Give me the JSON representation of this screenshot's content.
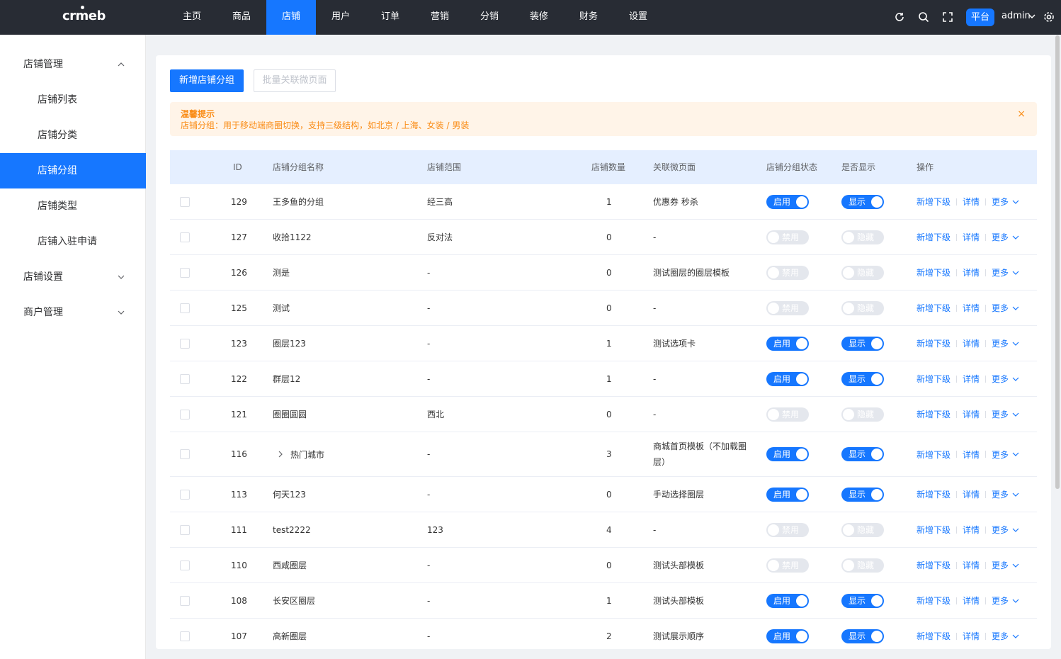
{
  "topbar": {
    "logo_text": "crmeb",
    "nav": [
      "主页",
      "商品",
      "店铺",
      "用户",
      "订单",
      "营销",
      "分销",
      "装修",
      "财务",
      "设置"
    ],
    "active_nav_index": 2,
    "platform_label": "平台",
    "user_name": "admin",
    "icons": [
      "refresh-icon",
      "search-icon",
      "fullscreen-icon",
      "chevron-down-icon",
      "settings-icon"
    ]
  },
  "sidebar": {
    "groups": [
      {
        "label": "店铺管理",
        "expanded": true,
        "items": [
          "店铺列表",
          "店铺分类",
          "店铺分组",
          "店铺类型",
          "店铺入驻申请"
        ]
      },
      {
        "label": "店铺设置",
        "expanded": false
      },
      {
        "label": "商户管理",
        "expanded": false
      }
    ],
    "active_item": "店铺分组"
  },
  "toolbar": {
    "add_label": "新增店铺分组",
    "batch_label": "批量关联微页面"
  },
  "alert": {
    "title": "温馨提示",
    "text": "店铺分组：用于移动端商圈切换，支持三级结构，如北京 / 上海、女装 / 男装",
    "close": "×"
  },
  "table": {
    "headers": [
      "ID",
      "店铺分组名称",
      "店铺范围",
      "店铺数量",
      "关联微页面",
      "店铺分组状态",
      "是否显示",
      "操作"
    ],
    "status_labels": {
      "on": "启用",
      "off": "禁用"
    },
    "show_labels": {
      "on": "显示",
      "off": "隐藏"
    },
    "actions": {
      "add_child": "新增下级",
      "detail": "详情",
      "more": "更多"
    },
    "rows": [
      {
        "id": "129",
        "name": "王多鱼的分组",
        "scope": "经三高",
        "count": "1",
        "page": "优惠券 秒杀",
        "status": true,
        "show": true
      },
      {
        "id": "127",
        "name": "收拾1122",
        "scope": "反对法",
        "count": "0",
        "page": "-",
        "status": false,
        "show": false
      },
      {
        "id": "126",
        "name": "测是",
        "scope": "-",
        "count": "0",
        "page": "测试圈层的圈层模板",
        "status": false,
        "show": false
      },
      {
        "id": "125",
        "name": "测试",
        "scope": "-",
        "count": "0",
        "page": "-",
        "status": false,
        "show": false
      },
      {
        "id": "123",
        "name": "圈层123",
        "scope": "-",
        "count": "1",
        "page": "测试选项卡",
        "status": true,
        "show": true
      },
      {
        "id": "122",
        "name": "群层12",
        "scope": "-",
        "count": "1",
        "page": "-",
        "status": true,
        "show": true
      },
      {
        "id": "121",
        "name": "圈圈圆圆",
        "scope": "西北",
        "count": "0",
        "page": "-",
        "status": false,
        "show": false
      },
      {
        "id": "116",
        "name": "热门城市",
        "scope": "-",
        "count": "3",
        "page": "商城首页模板（不加载圈层）",
        "status": true,
        "show": true,
        "expandable": true
      },
      {
        "id": "113",
        "name": "何天123",
        "scope": "-",
        "count": "0",
        "page": "手动选择圈层",
        "status": true,
        "show": true
      },
      {
        "id": "111",
        "name": "test2222",
        "scope": "123",
        "count": "4",
        "page": "-",
        "status": false,
        "show": false
      },
      {
        "id": "110",
        "name": "西咸圈层",
        "scope": "-",
        "count": "0",
        "page": "测试头部模板",
        "status": false,
        "show": false
      },
      {
        "id": "108",
        "name": "长安区圈层",
        "scope": "-",
        "count": "1",
        "page": "测试头部模板",
        "status": true,
        "show": true
      },
      {
        "id": "107",
        "name": "高新圈层",
        "scope": "-",
        "count": "2",
        "page": "测试展示顺序",
        "status": true,
        "show": true
      }
    ]
  }
}
